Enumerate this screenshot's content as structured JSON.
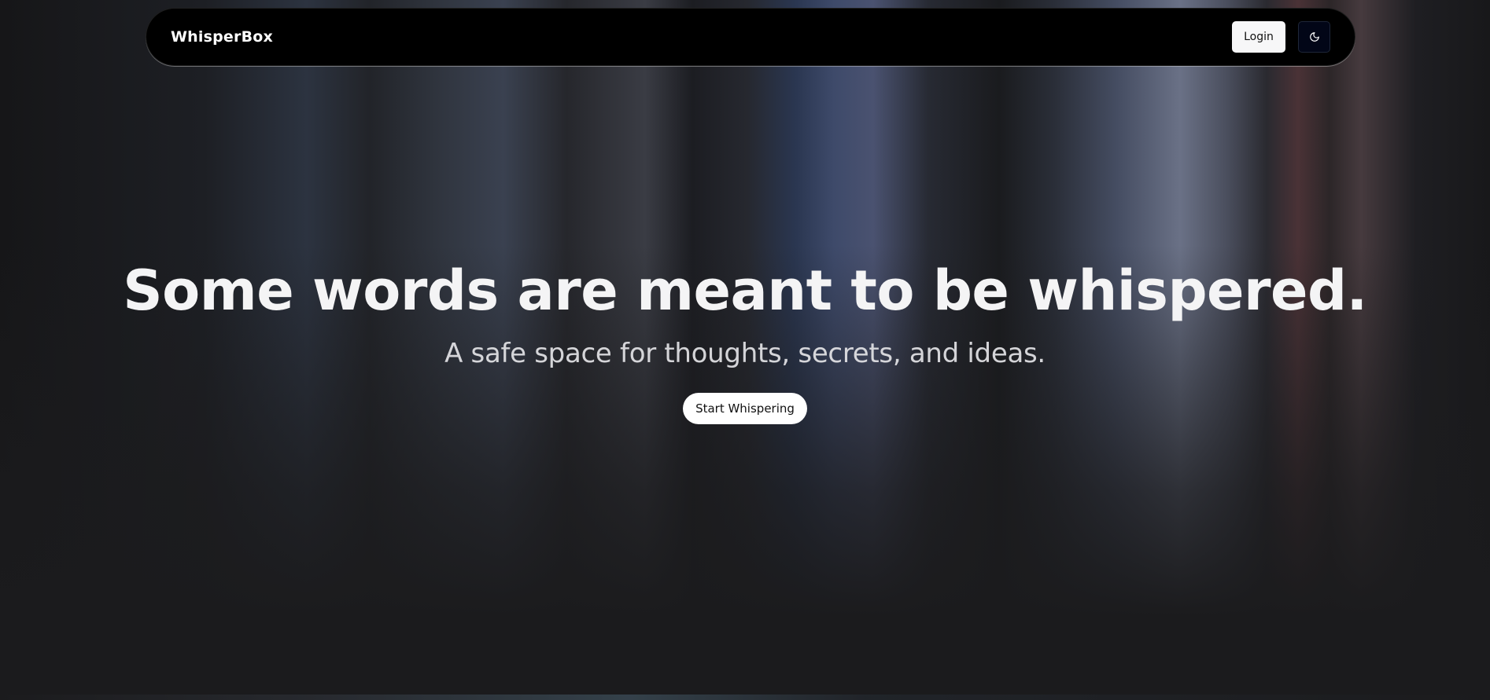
{
  "navbar": {
    "brand": "WhisperBox",
    "login_label": "Login",
    "theme_toggle_icon": "moon-icon"
  },
  "hero": {
    "title": "Some words are meant to be whispered.",
    "subtitle": "A safe space for thoughts, secrets, and ideas.",
    "cta_label": "Start Whispering"
  },
  "colors": {
    "background": "#1b1b1d",
    "navbar": "#000000",
    "text": "#f4f4f5"
  }
}
